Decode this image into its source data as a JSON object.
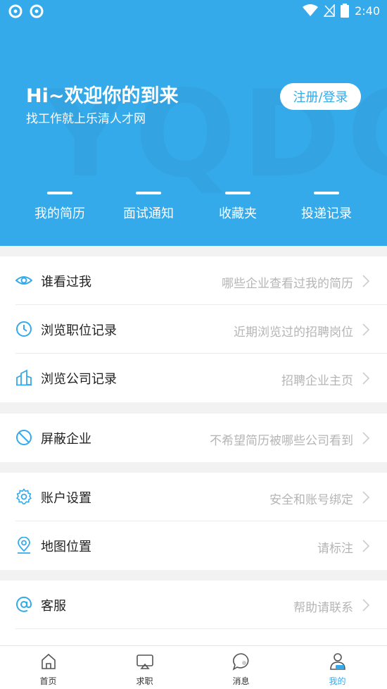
{
  "status_bar": {
    "time": "2:40"
  },
  "hero": {
    "title": "Hi~欢迎你的到来",
    "subtitle": "找工作就上乐清人才网",
    "login_button": "注册/登录",
    "quick_links": [
      {
        "label": "我的简历"
      },
      {
        "label": "面试通知"
      },
      {
        "label": "收藏夹"
      },
      {
        "label": "投递记录"
      }
    ]
  },
  "menu": {
    "who_viewed": {
      "label": "谁看过我",
      "hint": "哪些企业查看过我的简历",
      "icon": "eye-icon"
    },
    "browsed_jobs": {
      "label": "浏览职位记录",
      "hint": "近期浏览过的招聘岗位",
      "icon": "clock-icon"
    },
    "browsed_companies": {
      "label": "浏览公司记录",
      "hint": "招聘企业主页",
      "icon": "building-icon"
    },
    "block_companies": {
      "label": "屏蔽企业",
      "hint": "不希望简历被哪些公司看到",
      "icon": "block-icon"
    },
    "account_settings": {
      "label": "账户设置",
      "hint": "安全和账号绑定",
      "icon": "gear-icon"
    },
    "map_location": {
      "label": "地图位置",
      "hint": "请标注",
      "icon": "location-pin-icon"
    },
    "customer_service": {
      "label": "客服",
      "hint": "帮助请联系",
      "icon": "at-icon"
    }
  },
  "tabbar": {
    "home": "首页",
    "jobs": "求职",
    "messages": "消息",
    "mine": "我的"
  },
  "colors": {
    "accent": "#35aaea",
    "hint": "#b5b5b5",
    "background": "#f2f2f2"
  }
}
